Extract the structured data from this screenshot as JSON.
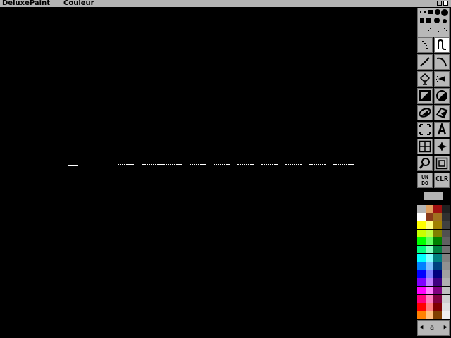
{
  "titlebar": {
    "app_title": "DeluxePaint",
    "menu_title": "Couleur"
  },
  "toolbar": {
    "tools": [
      {
        "name": "dotted-freehand-tool"
      },
      {
        "name": "continuous-freehand-tool",
        "selected": true
      },
      {
        "name": "line-tool"
      },
      {
        "name": "curve-tool"
      },
      {
        "name": "fill-tool"
      },
      {
        "name": "airbrush-tool"
      },
      {
        "name": "rectangle-tool"
      },
      {
        "name": "circle-tool"
      },
      {
        "name": "ellipse-tool"
      },
      {
        "name": "polygon-tool"
      },
      {
        "name": "brush-select-tool"
      },
      {
        "name": "text-tool"
      },
      {
        "name": "grid-tool"
      },
      {
        "name": "symmetry-tool"
      },
      {
        "name": "magnify-tool"
      },
      {
        "name": "zoom-tool"
      }
    ],
    "undo_label_top": "UN",
    "undo_label_bottom": "DO",
    "clr_label": "CLR"
  },
  "current_color": "#b4b4b4",
  "palette_columns": [
    [
      "#b4b4b4",
      "#ffffff",
      "#ffff00",
      "#c8ff00",
      "#00ff00",
      "#00ff80",
      "#00ffff",
      "#0080ff",
      "#0000ff",
      "#8000ff",
      "#ff00ff",
      "#ff0080",
      "#ff0000",
      "#ff8000"
    ],
    [
      "#e0a060",
      "#8a3a1a",
      "#ffff80",
      "#c0ff40",
      "#60ff60",
      "#80ffc0",
      "#80ffff",
      "#80c0ff",
      "#8080ff",
      "#c080ff",
      "#ff80ff",
      "#ff80c0",
      "#ff8080",
      "#ffc080"
    ],
    [
      "#a01010",
      "#a07020",
      "#a08000",
      "#808000",
      "#008000",
      "#008040",
      "#008080",
      "#004080",
      "#000080",
      "#400080",
      "#800080",
      "#800040",
      "#800000",
      "#804000"
    ],
    [
      "#202020",
      "#303030",
      "#404040",
      "#505050",
      "#606060",
      "#707070",
      "#808080",
      "#909090",
      "#a0a0a0",
      "#b0b0b0",
      "#c0c0c0",
      "#d0d0d0",
      "#e0e0e0",
      "#f0f0f0"
    ]
  ],
  "page_bar": {
    "left": "◀",
    "label": "a",
    "right": "▶"
  }
}
